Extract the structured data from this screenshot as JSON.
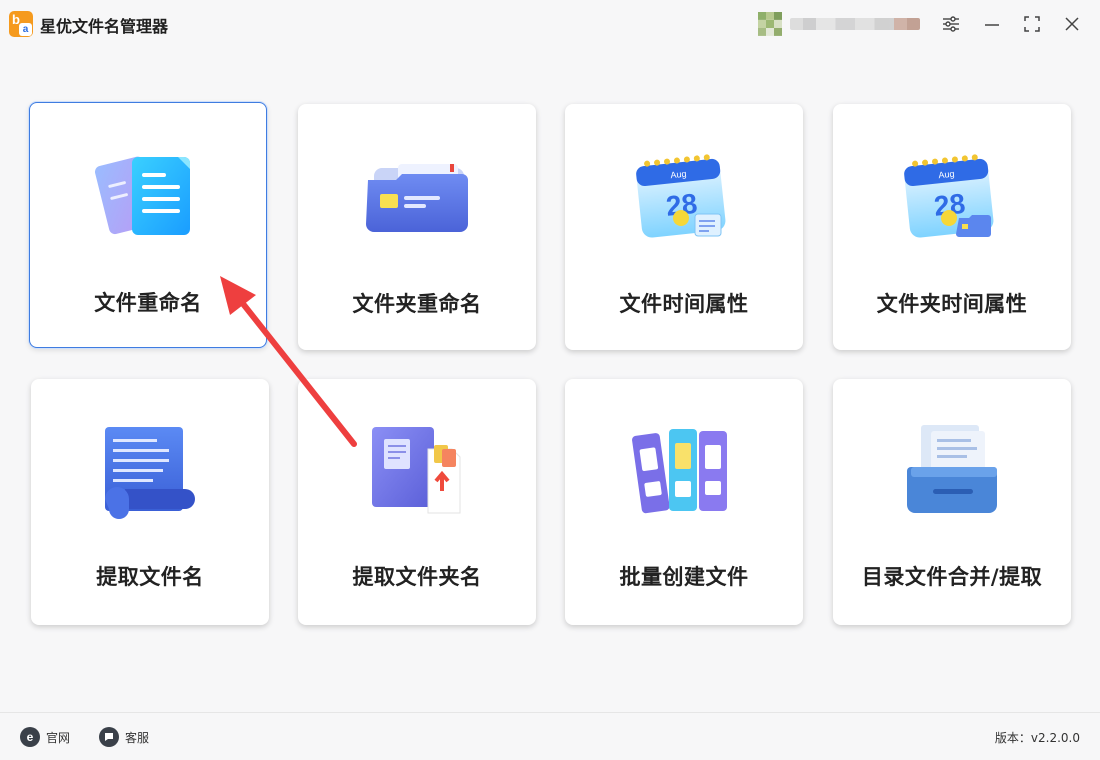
{
  "app": {
    "title": "星优文件名管理器",
    "logo_letters": [
      "b",
      "a"
    ],
    "user_name": "●●●●●●●●",
    "window_buttons": [
      "settings-icon",
      "minimize-icon",
      "maximize-icon",
      "close-icon"
    ]
  },
  "cards": [
    {
      "label": "文件重命名",
      "icon": "documents-icon",
      "selected": true
    },
    {
      "label": "文件夹重命名",
      "icon": "folder-icon"
    },
    {
      "label": "文件时间属性",
      "icon": "calendar-file-icon"
    },
    {
      "label": "文件夹时间属性",
      "icon": "calendar-folder-icon"
    },
    {
      "label": "提取文件名",
      "icon": "scroll-list-icon"
    },
    {
      "label": "提取文件夹名",
      "icon": "book-extract-icon"
    },
    {
      "label": "批量创建文件",
      "icon": "binders-icon"
    },
    {
      "label": "目录文件合并/提取",
      "icon": "file-drawer-icon"
    }
  ],
  "calendar": {
    "month": "Aug",
    "day": "28"
  },
  "footer": {
    "website_label": "官网",
    "support_label": "客服",
    "version_text": "版本：v2.2.0.0"
  },
  "colors": {
    "accent": "#3f7ce0",
    "arrow": "#ee3f3f",
    "logo": "#f59a1e"
  }
}
